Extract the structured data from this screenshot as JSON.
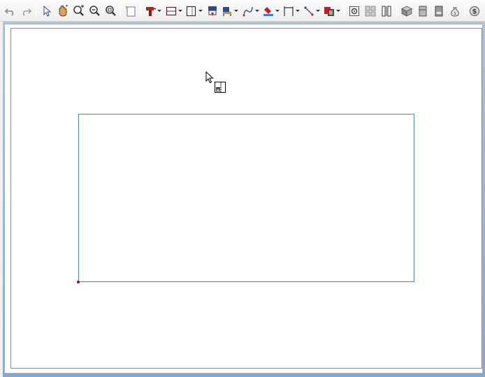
{
  "toolbar": {
    "buttons": [
      {
        "icon": "undo-icon"
      },
      {
        "icon": "redo-icon"
      },
      {
        "icon": "select-arrow-icon"
      },
      {
        "icon": "pan-hand-icon"
      },
      {
        "icon": "zoom-in-icon"
      },
      {
        "icon": "zoom-out-icon"
      },
      {
        "icon": "zoom-fit-icon"
      },
      {
        "icon": "new-page-icon"
      },
      {
        "icon": "drill-tool-icon"
      },
      {
        "icon": "wall-cabinet-icon"
      },
      {
        "icon": "door-icon"
      },
      {
        "icon": "appliance-icon"
      },
      {
        "icon": "chair-icon"
      },
      {
        "icon": "curve-line-icon"
      },
      {
        "icon": "paint-fill-icon"
      },
      {
        "icon": "dimension-icon"
      },
      {
        "icon": "line-tool-icon"
      },
      {
        "icon": "layer-color-icon"
      },
      {
        "icon": "settings-icon"
      },
      {
        "icon": "grid-icon"
      },
      {
        "icon": "columns-icon"
      },
      {
        "icon": "3d-box-icon"
      },
      {
        "icon": "cabinet-elevation-icon"
      },
      {
        "icon": "fridge-icon"
      },
      {
        "icon": "money-bag-icon"
      },
      {
        "icon": "pricing-icon"
      }
    ]
  },
  "canvas": {
    "background": "#ffffff",
    "room_outline_color": "#4f81b5",
    "corner_marker_color": "#b00000"
  }
}
